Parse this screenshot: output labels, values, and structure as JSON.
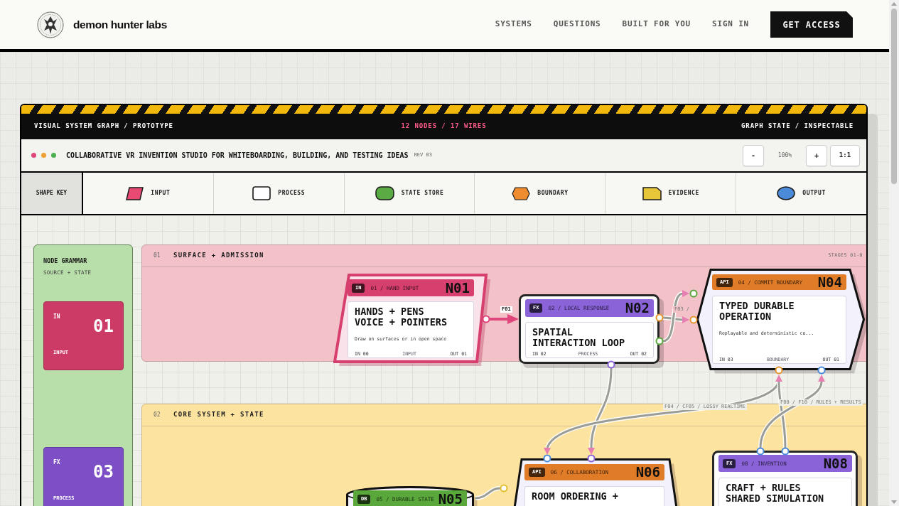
{
  "header": {
    "brand": "demon hunter labs",
    "nav": [
      "SYSTEMS",
      "QUESTIONS",
      "BUILT FOR YOU",
      "SIGN IN"
    ],
    "cta": "GET ACCESS"
  },
  "panel": {
    "bar": {
      "left": "VISUAL SYSTEM GRAPH / PROTOTYPE",
      "center": "12 NODES / 17 WIRES",
      "right": "GRAPH STATE / INSPECTABLE"
    },
    "titlebar": {
      "dots": [
        {
          "color": "#e0457b"
        },
        {
          "color": "#f0a030"
        },
        {
          "color": "#4caf50"
        }
      ],
      "title": "COLLABORATIVE VR INVENTION STUDIO FOR WHITEBOARDING, BUILDING, AND TESTING IDEAS",
      "revision": "REV 03",
      "zoom_out": "-",
      "zoom_level": "100%",
      "zoom_in": "+",
      "zoom_reset": "1:1"
    },
    "shape_key": {
      "label": "SHAPE KEY",
      "items": [
        {
          "kind": "input",
          "label": "INPUT"
        },
        {
          "kind": "process",
          "label": "PROCESS"
        },
        {
          "kind": "store",
          "label": "STATE STORE"
        },
        {
          "kind": "boundary",
          "label": "BOUNDARY"
        },
        {
          "kind": "evidence",
          "label": "EVIDENCE"
        },
        {
          "kind": "output",
          "label": "OUTPUT"
        }
      ]
    }
  },
  "canvas": {
    "grammar": {
      "title": "NODE GRAMMAR",
      "subtitle": "SOURCE + STATE",
      "cards": [
        {
          "kind": "input",
          "tag": "IN",
          "number": "01",
          "label": "INPUT"
        },
        {
          "kind": "process",
          "tag": "FX",
          "number": "03",
          "label": "PROCESS"
        }
      ]
    },
    "stages": [
      {
        "number": "01",
        "title": "SURFACE + ADMISSION",
        "range": "STAGES 01-0",
        "color": "#f2c2c8"
      },
      {
        "number": "02",
        "title": "CORE SYSTEM + STATE",
        "color": "#fde3a0"
      }
    ],
    "nodes": [
      {
        "kind": "parallelogram",
        "color": "#d63f6e",
        "tag": "IN",
        "caption": "01 / HAND INPUT",
        "id": "N01",
        "title": "HANDS + PENS\nVOICE + POINTERS",
        "description": "Draw on surfaces or in open space",
        "port_in": "IN 00",
        "role": "INPUT",
        "port_out": "OUT 01"
      },
      {
        "kind": "rectangle",
        "color": "#8a63d8",
        "tag": "FX",
        "caption": "02 / LOCAL RESPONSE",
        "id": "N02",
        "title": "SPATIAL\nINTERACTION LOOP",
        "port_in": "IN 02",
        "role": "PROCESS",
        "port_out": "OUT 02"
      },
      {
        "kind": "hexagon",
        "color": "#e07b28",
        "tag": "API",
        "caption": "04 / COMMIT BOUNDARY",
        "id": "N04",
        "title": "TYPED DURABLE\nOPERATION",
        "description": "Replayable and deterministic co...",
        "port_in": "IN 03",
        "role": "BOUNDARY",
        "port_out": "OUT 01"
      },
      {
        "kind": "cylinder",
        "color": "#5aa83c",
        "tag": "DB",
        "caption": "05 / DURABLE STATE",
        "id": "N05"
      },
      {
        "kind": "trapezoid",
        "color": "#e07b28",
        "tag": "API",
        "caption": "06 / COLLABORATION",
        "id": "N06",
        "title": "ROOM ORDERING +"
      },
      {
        "kind": "rectangle",
        "color": "#8a63d8",
        "tag": "FX",
        "caption": "08 / INVENTION",
        "id": "N08",
        "title": "CRAFT + RULES\nSHARED SIMULATION"
      }
    ],
    "wire_labels": [
      {
        "text": "F01"
      },
      {
        "text": "F03 /"
      },
      {
        "text": "F04 / CF05 / LOSSY REALTIME"
      },
      {
        "text": "F08 / F10 / RULES + RESULTS"
      }
    ]
  }
}
